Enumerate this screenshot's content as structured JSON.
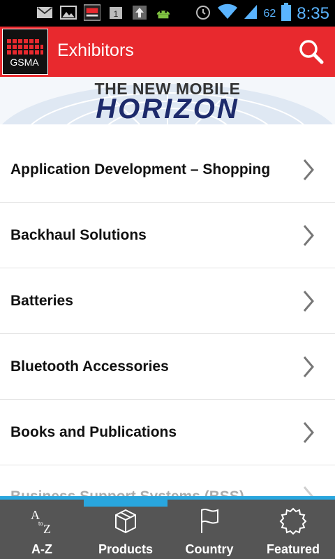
{
  "status_bar": {
    "battery_level": "62",
    "time": "8:35",
    "icons": [
      "gmail-icon",
      "gallery-icon",
      "gsma-icon",
      "calendar-icon",
      "upload-icon",
      "android-icon",
      "alarm-icon",
      "wifi-icon",
      "signal-icon",
      "battery-icon"
    ]
  },
  "app_bar": {
    "logo_text": "GSMA",
    "title": "Exhibitors",
    "search_icon": "search-icon"
  },
  "banner": {
    "line1": "THE NEW MOBILE",
    "line2": "HORIZON"
  },
  "list": {
    "items": [
      {
        "label": "Application Development – Shopping"
      },
      {
        "label": "Backhaul Solutions"
      },
      {
        "label": "Batteries"
      },
      {
        "label": "Bluetooth Accessories"
      },
      {
        "label": "Books and Publications"
      },
      {
        "label": "Business Support Systems (BSS)"
      }
    ]
  },
  "tabs": [
    {
      "label": "A-Z",
      "icon": "a-to-z-icon"
    },
    {
      "label": "Products",
      "icon": "box-icon"
    },
    {
      "label": "Country",
      "icon": "flag-icon"
    },
    {
      "label": "Featured",
      "icon": "badge-icon"
    }
  ],
  "colors": {
    "app_bar": "#e8292e",
    "tab_bar": "#555555",
    "accent": "#29a6de",
    "status_text": "#5ab4ff"
  },
  "active_tab": "Products"
}
